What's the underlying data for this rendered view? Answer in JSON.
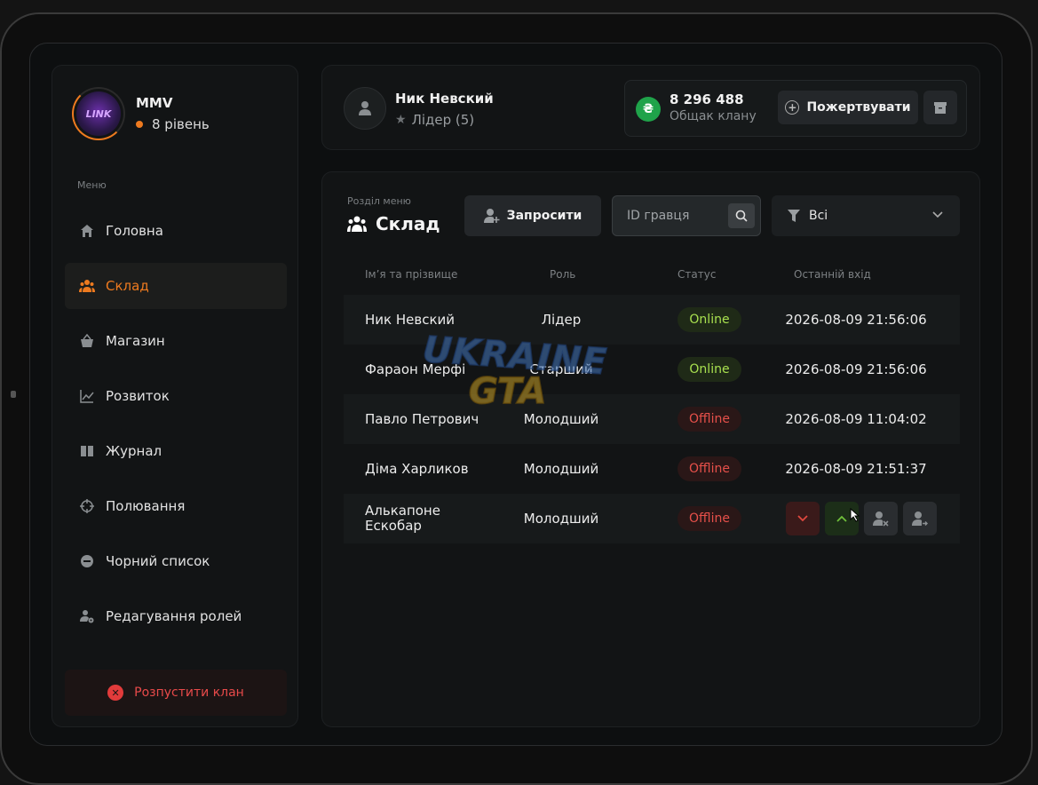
{
  "clan": {
    "name": "MMV",
    "level": "8 рівень",
    "avatar_text": "LINK"
  },
  "sidebar": {
    "menu_caption": "Меню",
    "items": [
      {
        "label": "Головна",
        "icon": "home-icon",
        "active": false
      },
      {
        "label": "Склад",
        "icon": "people-icon",
        "active": true
      },
      {
        "label": "Магазин",
        "icon": "basket-icon",
        "active": false
      },
      {
        "label": "Розвиток",
        "icon": "chart-icon",
        "active": false
      },
      {
        "label": "Журнал",
        "icon": "book-icon",
        "active": false
      },
      {
        "label": "Полювання",
        "icon": "crosshair-icon",
        "active": false
      },
      {
        "label": "Чорний список",
        "icon": "block-icon",
        "active": false
      },
      {
        "label": "Редагування ролей",
        "icon": "user-gear-icon",
        "active": false
      }
    ],
    "disband_label": "Розпустити клан"
  },
  "header": {
    "user_name": "Ник Невский",
    "user_role": "Лідер (5)",
    "bank_amount": "8 296 488",
    "bank_label": "Общак клану",
    "currency_symbol": "₴",
    "donate_label": "Пожертвувати"
  },
  "main": {
    "section_caption": "Розділ меню",
    "section_title": "Склад",
    "invite_label": "Запросити",
    "search_placeholder": "ID гравця",
    "filter_value": "Всі",
    "columns": [
      "Ім’я та прізвище",
      "Роль",
      "Статус",
      "Останній вхід"
    ],
    "rows": [
      {
        "name": "Ник Невский",
        "role": "Лідер",
        "status": "Online",
        "last_login": "2026-08-09 21:56:06"
      },
      {
        "name": "Фараон Мерфі",
        "role": "Старший",
        "status": "Online",
        "last_login": "2026-08-09 21:56:06"
      },
      {
        "name": "Павло Петрович",
        "role": "Молодший",
        "status": "Offline",
        "last_login": "2026-08-09 11:04:02"
      },
      {
        "name": "Діма Харликов",
        "role": "Молодший",
        "status": "Offline",
        "last_login": "2026-08-09 21:51:37"
      },
      {
        "name": "Алькапоне Ескобар",
        "role": "Молодший",
        "status": "Offline",
        "last_login": ""
      }
    ]
  },
  "watermark": {
    "line1": "UKRAINE",
    "line2": "GTA"
  },
  "colors": {
    "accent": "#ee7a1f",
    "online": "#a8e04f",
    "offline": "#e6504a",
    "danger": "#e23b3b",
    "coin": "#1fa34a"
  }
}
